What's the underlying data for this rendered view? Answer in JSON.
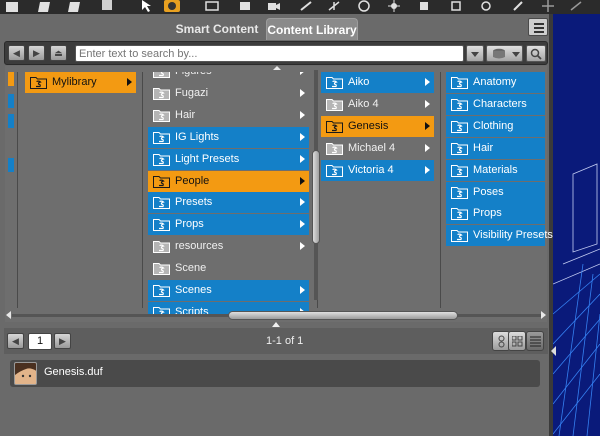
{
  "tabs": {
    "smart": "Smart Content",
    "library": "Content Library"
  },
  "search": {
    "placeholder": "Enter text to search by..."
  },
  "columns": {
    "c1": [
      {
        "label": "Mylibrary",
        "state": "selected",
        "icon": "folder-icon",
        "arrow": true
      }
    ],
    "c2": [
      {
        "label": "Figures",
        "state": "plain",
        "arrow": true
      },
      {
        "label": "Fugazi",
        "state": "plain",
        "arrow": true
      },
      {
        "label": "Hair",
        "state": "plain",
        "arrow": true
      },
      {
        "label": "IG Lights",
        "state": "highlight",
        "arrow": true
      },
      {
        "label": "Light Presets",
        "state": "highlight",
        "arrow": true
      },
      {
        "label": "People",
        "state": "selected",
        "arrow": true
      },
      {
        "label": "Presets",
        "state": "highlight",
        "arrow": true
      },
      {
        "label": "Props",
        "state": "highlight",
        "arrow": true
      },
      {
        "label": "resources",
        "state": "plain",
        "arrow": true
      },
      {
        "label": "Scene",
        "state": "plain",
        "arrow": false
      },
      {
        "label": "Scenes",
        "state": "highlight",
        "arrow": true
      },
      {
        "label": "Scripts",
        "state": "highlight",
        "arrow": true
      }
    ],
    "c3": [
      {
        "label": "Aiko",
        "state": "highlight",
        "arrow": true
      },
      {
        "label": "Aiko 4",
        "state": "plain",
        "arrow": true
      },
      {
        "label": "Genesis",
        "state": "selected",
        "arrow": true
      },
      {
        "label": "Michael 4",
        "state": "plain",
        "arrow": true
      },
      {
        "label": "Victoria 4",
        "state": "highlight",
        "arrow": true
      }
    ],
    "c4": [
      {
        "label": "Anatomy",
        "state": "highlight"
      },
      {
        "label": "Characters",
        "state": "highlight"
      },
      {
        "label": "Clothing",
        "state": "highlight"
      },
      {
        "label": "Hair",
        "state": "highlight"
      },
      {
        "label": "Materials",
        "state": "highlight"
      },
      {
        "label": "Poses",
        "state": "highlight"
      },
      {
        "label": "Props",
        "state": "highlight"
      },
      {
        "label": "Visibility Presets",
        "state": "highlight"
      }
    ]
  },
  "pager": {
    "page": "1",
    "info": "1-1 of 1"
  },
  "results": [
    {
      "label": "Genesis.duf"
    }
  ],
  "colors": {
    "highlight": "#1480c8",
    "selected": "#f39a12",
    "panel": "#6e6e6e",
    "viewport": "#0a1a7a"
  }
}
